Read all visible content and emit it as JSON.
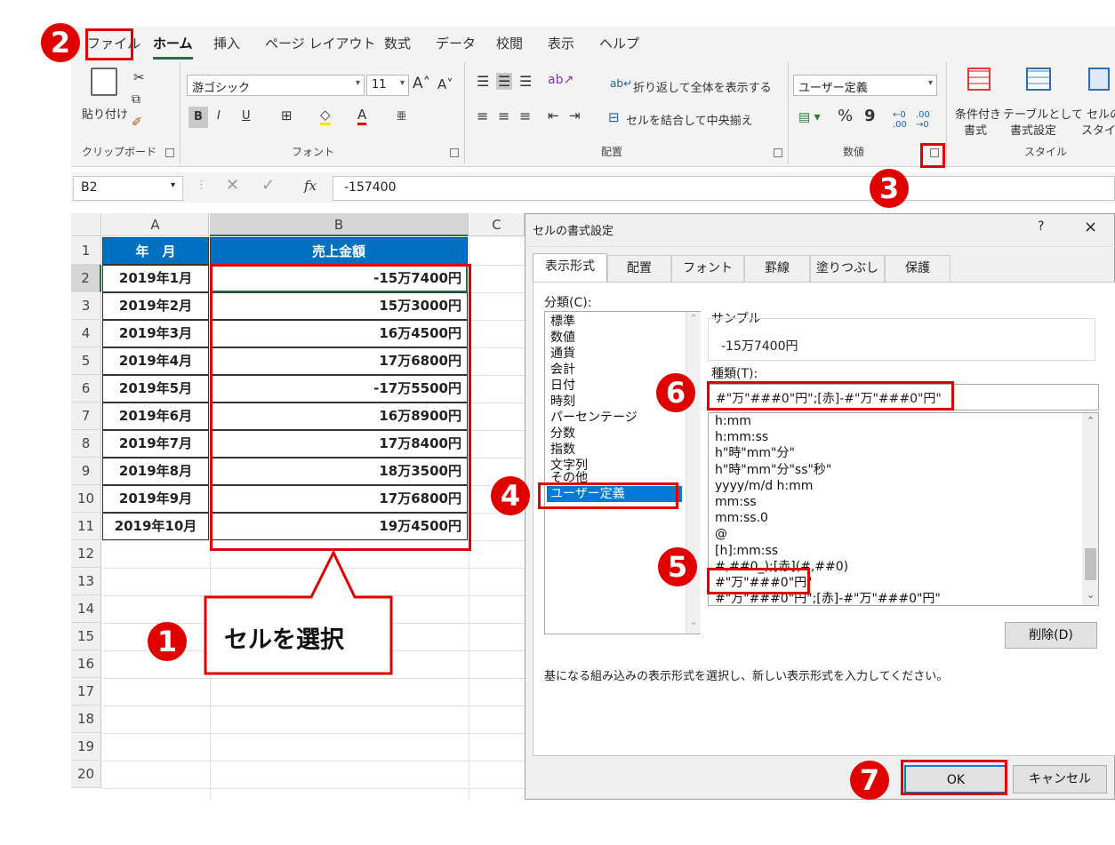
{
  "ribbon": {
    "tabs": [
      "ファイル",
      "ホーム",
      "挿入",
      "ページ レイアウト",
      "数式",
      "データ",
      "校閲",
      "表示",
      "ヘルプ"
    ],
    "clipboard": {
      "paste": "貼り付け",
      "group": "クリップボード"
    },
    "font": {
      "name": "游ゴシック",
      "size": "11",
      "group": "フォント",
      "bold": "B",
      "italic": "I",
      "underline": "U"
    },
    "alignment": {
      "wrap": "折り返して全体を表示する",
      "merge": "セルを結合して中央揃え",
      "group": "配置"
    },
    "number": {
      "format": "ユーザー定義",
      "percent": "%",
      "comma": "9",
      "group": "数値"
    },
    "styles": {
      "cond": "条件付き",
      "cond2": "書式",
      "table": "テーブルとして",
      "table2": "書式設定",
      "cell": "セルの",
      "cell2": "スタイル",
      "group": "スタイル"
    }
  },
  "formula_bar": {
    "name_box": "B2",
    "fx": "fx",
    "value": "-157400"
  },
  "sheet": {
    "columns": [
      "A",
      "B",
      "C"
    ],
    "header": {
      "a": "年　月",
      "b": "売上金額"
    },
    "rows": [
      {
        "a": "2019年1月",
        "b": "-15万7400円"
      },
      {
        "a": "2019年2月",
        "b": "15万3000円"
      },
      {
        "a": "2019年3月",
        "b": "16万4500円"
      },
      {
        "a": "2019年4月",
        "b": "17万6800円"
      },
      {
        "a": "2019年5月",
        "b": "-17万5500円"
      },
      {
        "a": "2019年6月",
        "b": "16万8900円"
      },
      {
        "a": "2019年7月",
        "b": "17万8400円"
      },
      {
        "a": "2019年8月",
        "b": "18万3500円"
      },
      {
        "a": "2019年9月",
        "b": "17万6800円"
      },
      {
        "a": "2019年10月",
        "b": "19万4500円"
      }
    ],
    "row_numbers": [
      "1",
      "2",
      "3",
      "4",
      "5",
      "6",
      "7",
      "8",
      "9",
      "10",
      "11",
      "12",
      "13",
      "14",
      "15",
      "16",
      "17",
      "18",
      "19",
      "20"
    ]
  },
  "callout": {
    "text": "セルを選択"
  },
  "badges": [
    "1",
    "2",
    "3",
    "4",
    "5",
    "6",
    "7"
  ],
  "dialog": {
    "title": "セルの書式設定",
    "help": "?",
    "close": "×",
    "tabs": [
      "表示形式",
      "配置",
      "フォント",
      "罫線",
      "塗りつぶし",
      "保護"
    ],
    "category_label": "分類(C):",
    "categories": [
      "標準",
      "数値",
      "通貨",
      "会計",
      "日付",
      "時刻",
      "パーセンテージ",
      "分数",
      "指数",
      "文字列",
      "その他",
      "ユーザー定義"
    ],
    "sample_label": "サンプル",
    "sample_value": "-15万7400円",
    "type_label": "種類(T):",
    "type_value": "#\"万\"###0\"円\";[赤]-#\"万\"###0\"円\"",
    "type_list": [
      "h:mm",
      "h:mm:ss",
      "h\"時\"mm\"分\"",
      "h\"時\"mm\"分\"ss\"秒\"",
      "yyyy/m/d h:mm",
      "mm:ss",
      "mm:ss.0",
      "@",
      "[h]:mm:ss",
      "#,##0_);[赤](#,##0)",
      "#\"万\"###0\"円\"",
      "#\"万\"###0\"円\";[赤]-#\"万\"###0\"円\""
    ],
    "delete": "削除(D)",
    "description": "基になる組み込みの表示形式を選択し、新しい表示形式を入力してください。",
    "ok": "OK",
    "cancel": "キャンセル"
  },
  "colors": {
    "accent_red": "#e00000",
    "header_blue": "#0070c0",
    "excel_green": "#217346",
    "selection_blue": "#0078d7"
  }
}
